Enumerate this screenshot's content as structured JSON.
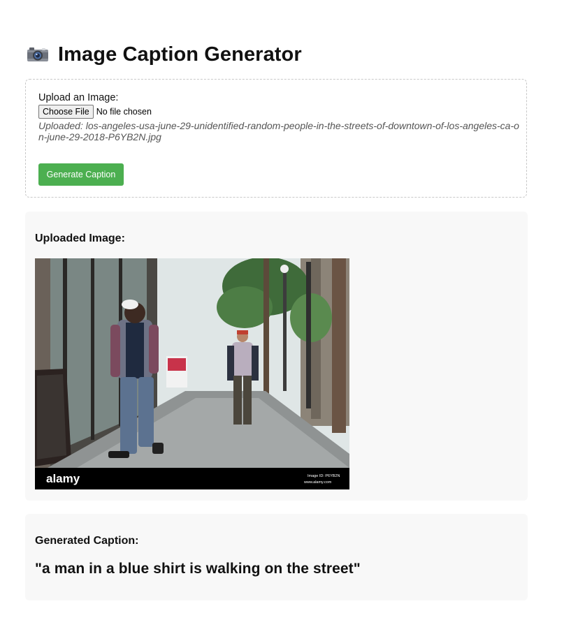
{
  "header": {
    "title": "Image Caption Generator",
    "icon": "camera-icon"
  },
  "upload": {
    "label": "Upload an Image:",
    "choose_button": "Choose File",
    "no_file_text": "No file chosen",
    "uploaded_note": "Uploaded: los-angeles-usa-june-29-unidentified-random-people-in-the-streets-of-downtown-of-los-angeles-ca-on-june-29-2018-P6YB2N.jpg",
    "generate_button": "Generate Caption"
  },
  "image_section": {
    "heading": "Uploaded Image:",
    "watermark_brand": "alamy",
    "watermark_id": "Image ID: P6YB2N",
    "watermark_site": "www.alamy.com"
  },
  "caption_section": {
    "heading": "Generated Caption:",
    "caption": "\"a man in a blue shirt is walking on the street\""
  },
  "colors": {
    "accent_green": "#4caf50",
    "panel_bg": "#f8f8f8",
    "border_dashed": "#c8c8c8"
  }
}
